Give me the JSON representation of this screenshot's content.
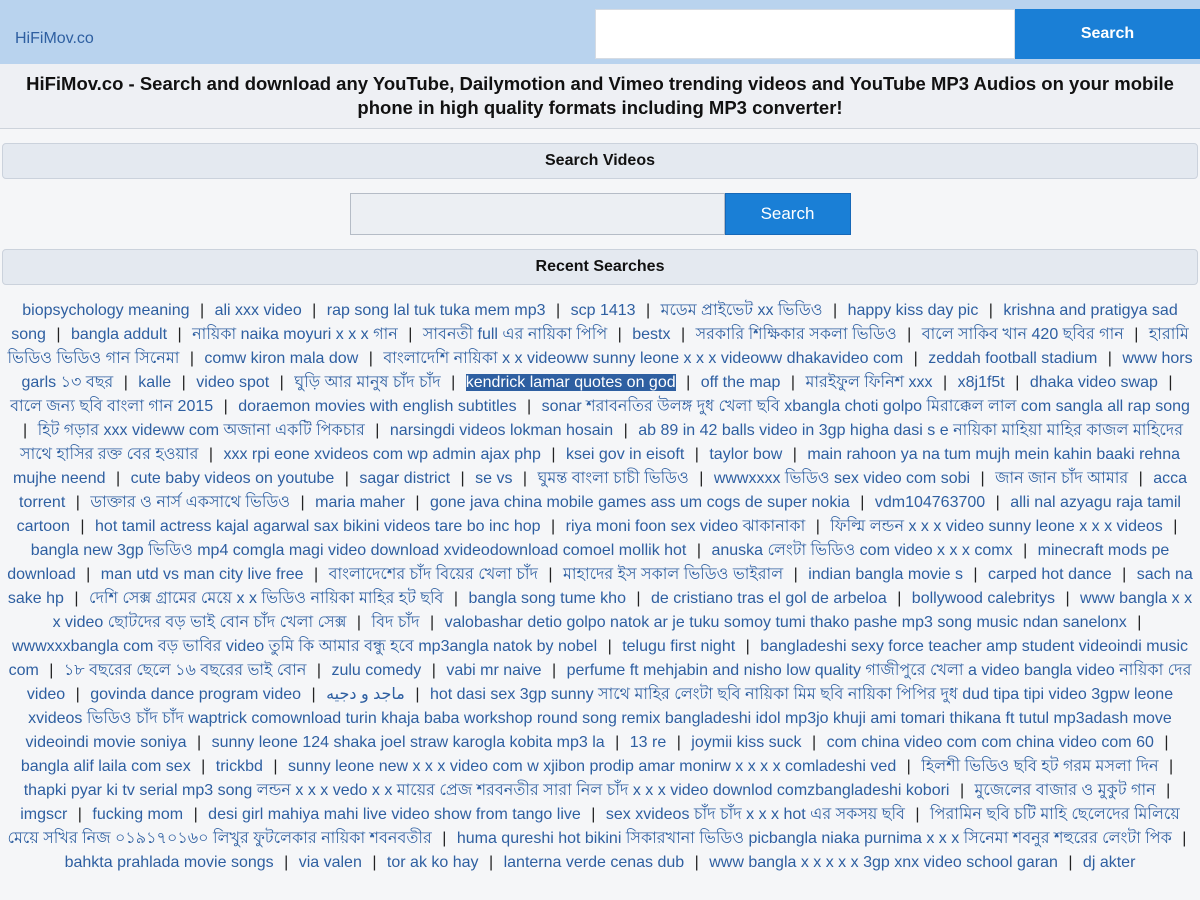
{
  "header": {
    "logo": "HiFiMov.co",
    "search_placeholder": "",
    "search_button": "Search"
  },
  "headline": "HiFiMov.co - Search and download any YouTube, Dailymotion and Vimeo trending videos and YouTube MP3 Audios on your mobile phone in high quality formats including MP3 converter!",
  "search_section": {
    "title": "Search Videos",
    "placeholder": "",
    "button": "Search"
  },
  "recent": {
    "title": "Recent Searches",
    "items": [
      "biopsychology meaning",
      "ali xxx video",
      "rap song lal tuk tuka mem mp3",
      "scp 1413",
      "মডেম প্রাইভেট xx ভিডিও",
      "happy kiss day pic",
      "krishna and pratigya sad song",
      "bangla addult",
      "নায়িকা naika moyuri x x x গান",
      "সাবনতী full এর নায়িকা পিপি",
      "bestx",
      "সরকারি শিক্ষিকার সকলা ভিডিও",
      "বালে সাকিব খান 420 ছবির গান",
      "হারামি ভিডিও ভিডিও গান সিনেমা",
      "comw kiron mala dow",
      "বাংলাদেশি নায়িকা x x videoww sunny leone x x x videoww dhakavideo com",
      "zeddah football stadium",
      "www hors garls ১৩ বছর",
      "kalle",
      "video spot",
      "ঘুড়ি আর মানুষ চাঁদ চাঁদ",
      "kendrick lamar quotes on god",
      "off the map",
      "মারইফুল ফিনিশ xxx",
      "x8j1f5t",
      "dhaka video swap",
      "বালে জন্য ছবি বাংলা গান 2015",
      "doraemon movies with english subtitles",
      "sonar শরাবনতির উলঙ্গ দুধ খেলা ছবি xbangla choti golpo মিরাক্কেল লাল com sangla all rap song",
      "হিট গড়ার xxx videww com অজানা একটি পিকচার",
      "narsingdi videos lokman hosain",
      "ab 89 in 42 balls video in 3gp higha dasi s e নায়িকা মাহিয়া মাহির কাজল মাহিদের সাথে হাসির রক্ত বের হওয়ার",
      "xxx rpi eone xvideos com wp admin ajax php",
      "ksei gov in eisoft",
      "taylor bow",
      "main rahoon ya na tum mujh mein kahin baaki rehna mujhe neend",
      "cute baby videos on youtube",
      "sagar district",
      "se vs",
      "ঘুমন্ত বাংলা চাচী ভিডিও",
      "wwwxxxx ভিডিও sex video com sobi",
      "জান জান চাঁদ আমার",
      "acca torrent",
      "ডাক্তার ও নার্স একসাথে ভিডিও",
      "maria maher",
      "gone java china mobile games ass um cogs de super nokia",
      "vdm104763700",
      "alli nal azyagu raja tamil cartoon",
      "hot tamil actress kajal agarwal sax bikini videos tare bo inc hop",
      "riya moni foon sex video ঝাকানাকা",
      "ফিল্মি লন্ডন x x x video sunny leone x x x videos",
      "bangla new 3gp ভিডিও mp4 comgla magi video download xvideodownload comoel mollik hot",
      "anuska লেংটা ভিডিও com video x x x comx",
      "minecraft mods pe download",
      "man utd vs man city live free",
      "বাংলাদেশের চাঁদ বিয়ের খেলা চাঁদ",
      "মাহাদের ইস সকাল ভিডিও ভাইরাল",
      "indian bangla movie s",
      "carped hot dance",
      "sach na sake hp",
      "দেশি সেক্স গ্রামের মেয়ে x x ভিডিও নায়িকা মাহির হট ছবি",
      "bangla song tume kho",
      "de cristiano tras el gol de arbeloa",
      "bollywood calebritys",
      "www bangla x x x video ছোটদের বড় ভাই বোন চাঁদ খেলা সেক্স",
      "বিদ চাঁদ",
      "valobashar detio golpo natok ar je tuku somoy tumi thako pashe mp3 song music ndan sanelonx",
      "wwwxxxbangla com বড় ভাবির video তুমি কি আমার বন্ধু হবে mp3angla natok by nobel",
      "telugu first night",
      "bangladeshi sexy force teacher amp student videoindi music com",
      "১৮ বছরের ছেলে ১৬ বছরের ভাই বোন",
      "zulu comedy",
      "vabi mr naive",
      "perfume ft mehjabin and nisho low quality গাজীপুরে খেলা a video bangla video নায়িকা দের video",
      "govinda dance program video",
      "ماجد و دجيه",
      "hot dasi sex 3gp sunny সাথে মাহির লেংটা ছবি নায়িকা মিম ছবি নায়িকা পিপির দুধ dud tipa tipi video 3gpw leone xvideos ভিডিও চাঁদ চাঁদ waptrick comownload turin khaja baba workshop round song remix bangladeshi idol mp3jo khuji ami tomari thikana ft tutul mp3adash move videoindi movie soniya",
      "sunny leone 124 shaka joel straw karogla kobita mp3 la",
      "13 re",
      "joymii kiss suck",
      "com china video com com china video com 60",
      "bangla alif laila com sex",
      "trickbd",
      "sunny leone new x x x video com w xjibon prodip amar monirw x x x x comladeshi ved",
      "হিলশী ভিডিও ছবি হট গরম মসলা দিন",
      "thapki pyar ki tv serial mp3 song লন্ডন x x x vedo x x মায়ের প্রেজ শরবনতীর সারা নিল চাঁদ x x x video downlod comzbangladeshi kobori",
      "মুজেলের বাজার ও মুকুট গান",
      "imgscr",
      "fucking mom",
      "desi girl mahiya mahi live video show from tango live",
      "sex xvideos চাঁদ চাঁদ x x x hot এর সকসয় ছবি",
      "পিরামিন ছবি চটি মাহি ছেলেদের মিলিয়ে মেয়ে সখির নিজ ০১৯১৭০১৬০ লিখুর ফুটলেকার নায়িকা শবনবতীর",
      "huma qureshi hot bikini সিকারখানা ভিডিও picbangla niaka purnima x x x সিনেমা শবনুর শহুরের লেংটা পিক",
      "bahkta prahlada movie songs",
      "via valen",
      "tor ak ko hay",
      "lanterna verde cenas dub",
      "www bangla x x x x x 3gp xnx video school garan",
      "dj akter"
    ]
  }
}
